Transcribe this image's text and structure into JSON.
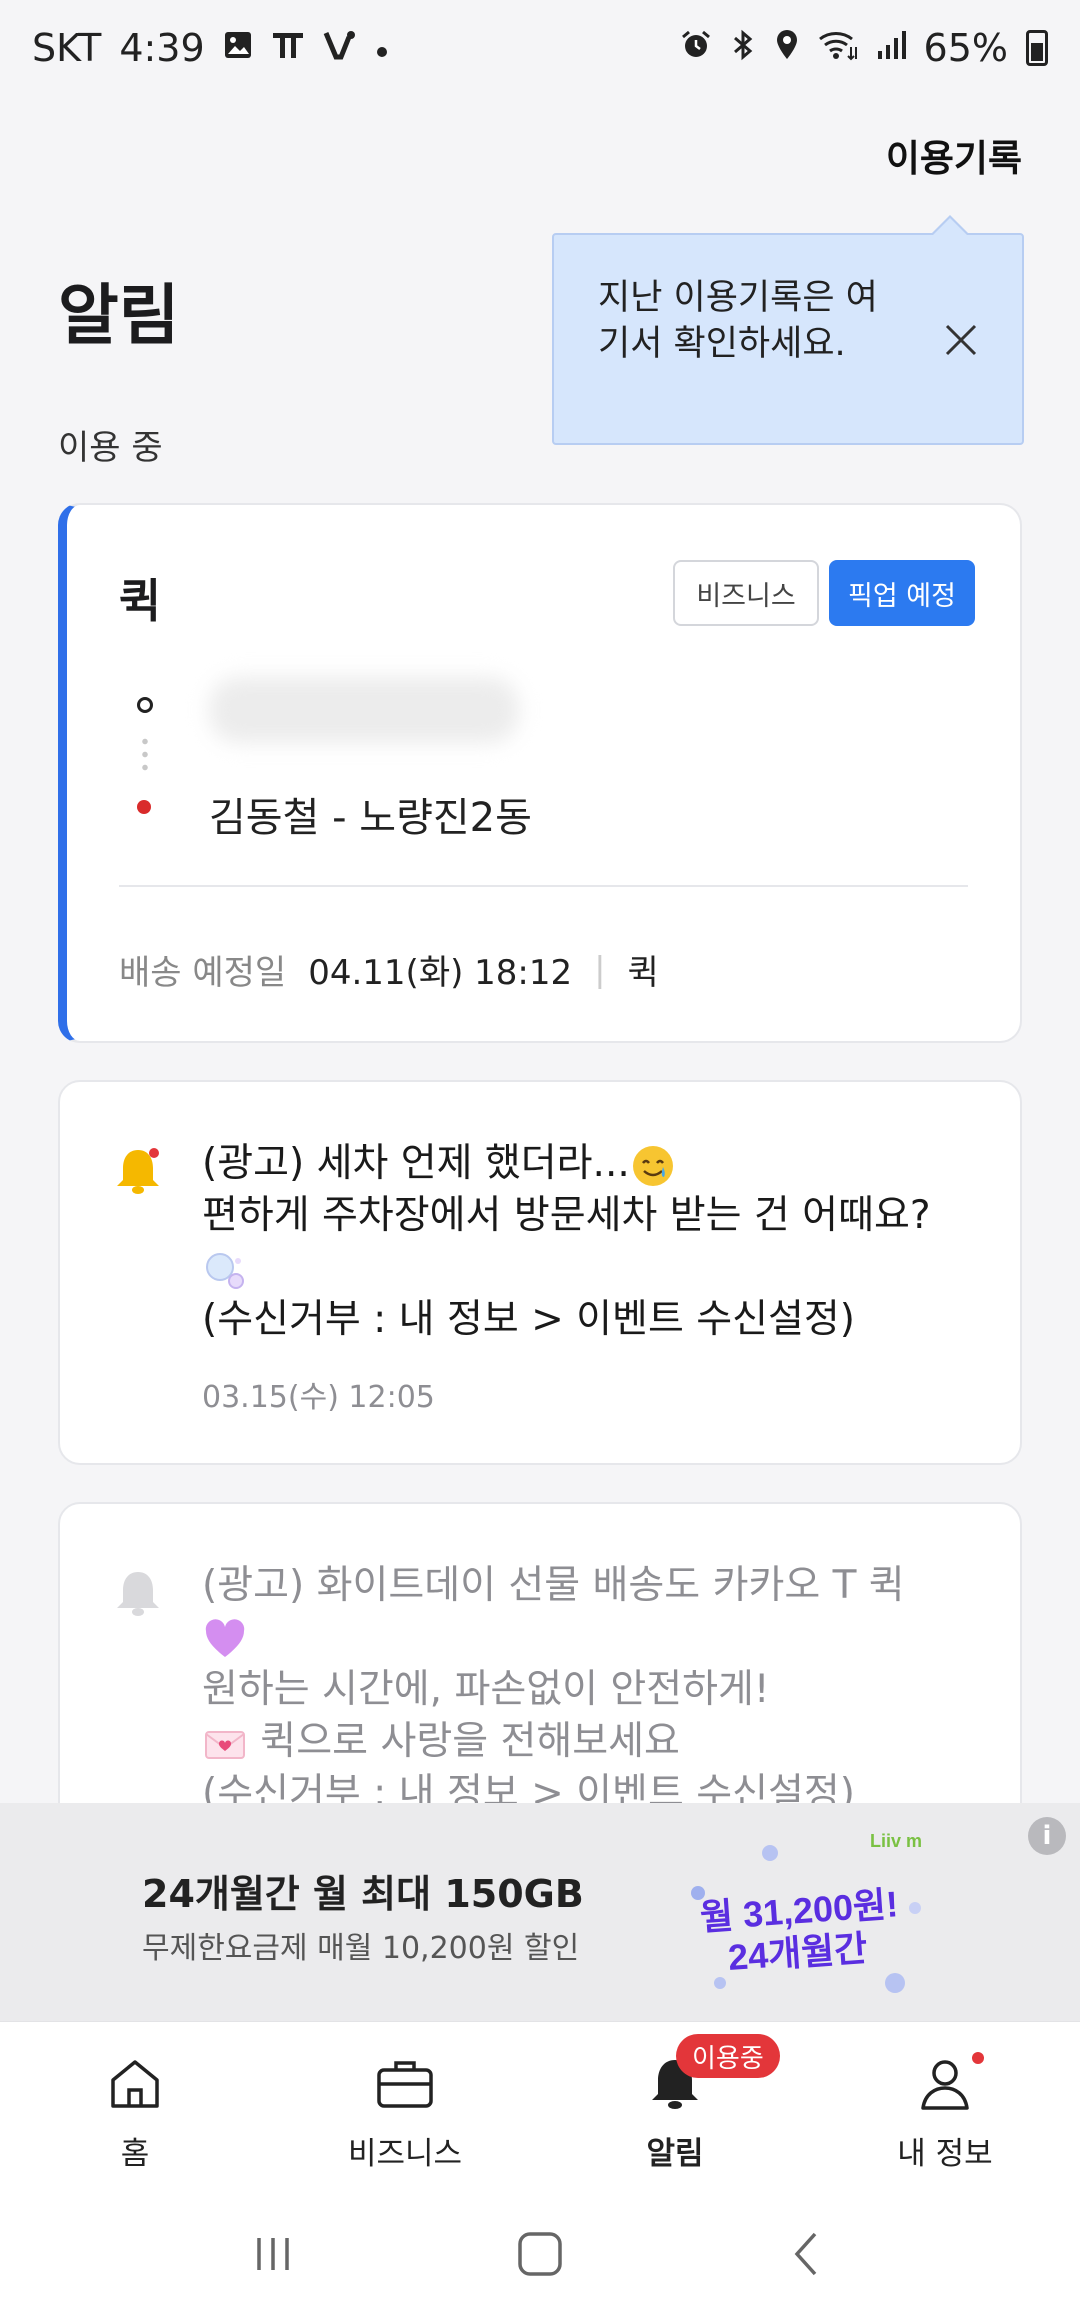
{
  "status_bar": {
    "carrier": "SKT",
    "time": "4:39",
    "battery": "65%",
    "left_icons": [
      "gallery-icon",
      "t-icon",
      "v-icon",
      "dot-icon"
    ],
    "right_icons": [
      "alarm-icon",
      "bluetooth-icon",
      "location-icon",
      "wifi-icon",
      "signal-icon",
      "battery-icon"
    ]
  },
  "header": {
    "history_link": "이용기록",
    "title": "알림",
    "section_label": "이용 중"
  },
  "tooltip": {
    "text": "지난 이용기록은 여기서 확인하세요."
  },
  "quick_card": {
    "title": "퀵",
    "badge_business": "비즈니스",
    "badge_status": "픽업 예정",
    "destination": "김동철 - 노량진2동",
    "delivery_label": "배송 예정일",
    "delivery_datetime": "04.11(화) 18:12",
    "delivery_separator": "|",
    "delivery_type": "퀵",
    "accent_color": "#2f6fe9"
  },
  "notices": [
    {
      "line1": "(광고) 세차 언제 했더라...",
      "line2": "편하게 주차장에서 방문세차 받는 건 어때요?",
      "line3": "(수신거부 : 내 정보 > 이벤트 수신설정)",
      "date": "03.15(수) 12:05",
      "unread": true
    },
    {
      "line1": "(광고) 화이트데이 선물 배송도 카카오 T 퀵",
      "line2": "원하는 시간에, 파손없이 안전하게!",
      "line3": "퀵으로 사랑을 전해보세요",
      "line4": "(수신거부 : 내 정보 > 이벤트 수신설정)",
      "unread": false
    }
  ],
  "ad": {
    "title": "24개월간 월 최대 150GB",
    "subtitle": "무제한요금제 매월 10,200원 할인",
    "promo_line1": "월 31,200원!",
    "promo_line2": "24개월간",
    "brand": "Liiv m",
    "info_label": "i"
  },
  "bottom_nav": {
    "items": [
      {
        "label": "홈",
        "icon": "home-icon"
      },
      {
        "label": "비즈니스",
        "icon": "briefcase-icon"
      },
      {
        "label": "알림",
        "icon": "bell-icon",
        "badge": "이용중",
        "active": true
      },
      {
        "label": "내 정보",
        "icon": "person-icon"
      }
    ]
  },
  "colors": {
    "primary": "#2c7af0",
    "badge_red": "#e3363a",
    "tooltip_bg": "#d6e6fc",
    "bell_yellow": "#f5b800"
  }
}
